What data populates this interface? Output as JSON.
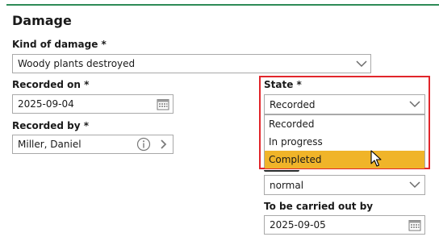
{
  "section": {
    "title": "Damage"
  },
  "kind_of_damage": {
    "label": "Kind of damage *",
    "value": "Woody plants destroyed"
  },
  "recorded_on": {
    "label": "Recorded on *",
    "value": "2025-09-04"
  },
  "recorded_by": {
    "label": "Recorded by *",
    "value": "Miller, Daniel"
  },
  "state": {
    "label": "State *",
    "value": "Recorded",
    "options": [
      "Recorded",
      "In progress",
      "Completed"
    ],
    "highlighted": "Completed"
  },
  "urgency": {
    "value": "normal"
  },
  "to_be_carried_out_by": {
    "label": "To be carried out by",
    "value": "2025-09-05"
  },
  "colors": {
    "accent_rule": "#2e8b57",
    "highlight_frame": "#e1262b",
    "selected_option": "#f0b429"
  },
  "icons": [
    "chevron-down-icon",
    "calendar-icon",
    "info-icon",
    "chevron-right-icon",
    "mouse-cursor-icon"
  ]
}
